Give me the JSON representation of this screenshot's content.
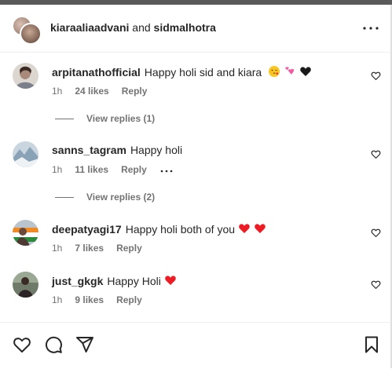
{
  "header": {
    "user1": "kiaraaliaadvani",
    "joiner": "and",
    "user2": "sidmalhotra"
  },
  "comments": [
    {
      "username": "arpitanathofficial",
      "text": "Happy holi sid and kiara",
      "emojis": [
        "face-blowing-kiss",
        "two-hearts",
        "black-heart"
      ],
      "time": "1h",
      "likes": "24 likes",
      "reply": "Reply"
    },
    {
      "username": "sanns_tagram",
      "text": "Happy holi",
      "emojis": [],
      "time": "1h",
      "likes": "11 likes",
      "reply": "Reply"
    },
    {
      "username": "deepatyagi17",
      "text": "Happy holi both of you",
      "emojis": [
        "red-heart",
        "red-heart"
      ],
      "time": "1h",
      "likes": "7 likes",
      "reply": "Reply"
    },
    {
      "username": "just_gkgk",
      "text": "Happy Holi",
      "emojis": [
        "red-heart"
      ],
      "time": "1h",
      "likes": "9 likes",
      "reply": "Reply"
    }
  ],
  "replies": [
    {
      "label": "View replies (1)"
    },
    {
      "label": "View replies (2)"
    }
  ],
  "icons": [
    "more-icon",
    "heart-icon",
    "comment-icon",
    "share-icon",
    "bookmark-icon"
  ],
  "colors": {
    "text": "#262626",
    "muted": "#737373",
    "red-heart": "#ed1c24",
    "divider": "#efefef"
  }
}
